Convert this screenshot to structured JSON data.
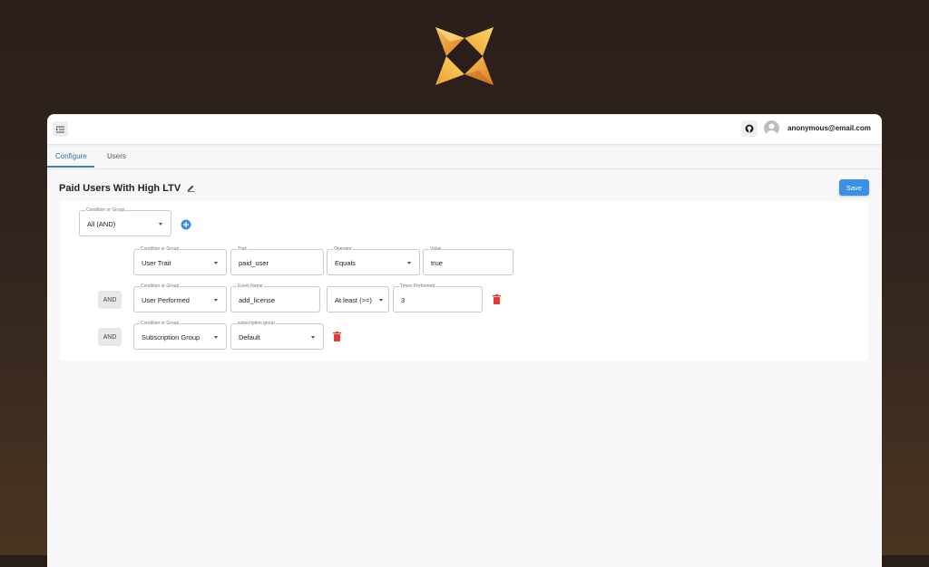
{
  "header": {
    "user_email": "anonymous@email.com"
  },
  "tabs": [
    {
      "label": "Configure",
      "active": true
    },
    {
      "label": "Users",
      "active": false
    }
  ],
  "segment": {
    "title": "Paid Users With High LTV"
  },
  "toolbar": {
    "save_label": "Save"
  },
  "root_group": {
    "label": "Condition or Group",
    "value": "All (AND)"
  },
  "conditions": [
    {
      "connector": "",
      "type": {
        "label": "Condition or Group",
        "value": "User Trait"
      },
      "trait": {
        "label": "Trait",
        "value": "paid_user"
      },
      "operator": {
        "label": "Operator",
        "value": "Equals"
      },
      "value": {
        "label": "Value",
        "value": "true"
      }
    },
    {
      "connector": "AND",
      "type": {
        "label": "Condition or Group",
        "value": "User Performed"
      },
      "event": {
        "label": "Event Name",
        "value": "add_license"
      },
      "operator": {
        "value": "At least (>=)"
      },
      "times": {
        "label": "Times Performed",
        "value": "3"
      }
    },
    {
      "connector": "AND",
      "type": {
        "label": "Condition or Group",
        "value": "Subscription Group"
      },
      "group": {
        "label": "subscription group",
        "value": "Default"
      }
    }
  ],
  "colors": {
    "accent": "#3b8fe6",
    "delete": "#e53935",
    "tab_active": "#2c6fb4"
  },
  "icons": [
    "logo-star-icon",
    "menu-icon",
    "github-icon",
    "avatar-icon",
    "edit-icon",
    "add-circle-icon",
    "trash-icon",
    "chevron-down-icon"
  ]
}
